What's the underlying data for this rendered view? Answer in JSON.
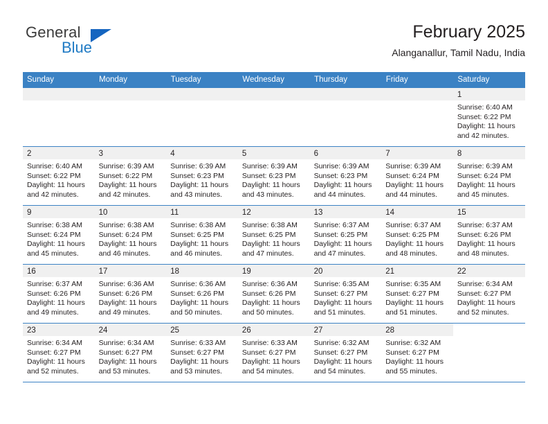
{
  "brand": {
    "name_part1": "General",
    "name_part2": "Blue",
    "triangle_color": "#1565c0",
    "blue_color": "#1f7ac4"
  },
  "header": {
    "title": "February 2025",
    "subtitle": "Alanganallur, Tamil Nadu, India"
  },
  "theme": {
    "header_bg": "#3b82c4",
    "header_text": "#ffffff",
    "daynum_band_bg": "#f0f0f0",
    "grid_line": "#3b82c4",
    "text": "#231f20"
  },
  "weekdays": [
    "Sunday",
    "Monday",
    "Tuesday",
    "Wednesday",
    "Thursday",
    "Friday",
    "Saturday"
  ],
  "labels": {
    "sunrise_prefix": "Sunrise:",
    "sunset_prefix": "Sunset:",
    "daylight_prefix": "Daylight:"
  },
  "weeks": [
    [
      {
        "day": "",
        "empty": true
      },
      {
        "day": "",
        "empty": true
      },
      {
        "day": "",
        "empty": true
      },
      {
        "day": "",
        "empty": true
      },
      {
        "day": "",
        "empty": true
      },
      {
        "day": "",
        "empty": true
      },
      {
        "day": "1",
        "sunrise": "Sunrise: 6:40 AM",
        "sunset": "Sunset: 6:22 PM",
        "daylight1": "Daylight: 11 hours",
        "daylight2": "and 42 minutes."
      }
    ],
    [
      {
        "day": "2",
        "sunrise": "Sunrise: 6:40 AM",
        "sunset": "Sunset: 6:22 PM",
        "daylight1": "Daylight: 11 hours",
        "daylight2": "and 42 minutes."
      },
      {
        "day": "3",
        "sunrise": "Sunrise: 6:39 AM",
        "sunset": "Sunset: 6:22 PM",
        "daylight1": "Daylight: 11 hours",
        "daylight2": "and 42 minutes."
      },
      {
        "day": "4",
        "sunrise": "Sunrise: 6:39 AM",
        "sunset": "Sunset: 6:23 PM",
        "daylight1": "Daylight: 11 hours",
        "daylight2": "and 43 minutes."
      },
      {
        "day": "5",
        "sunrise": "Sunrise: 6:39 AM",
        "sunset": "Sunset: 6:23 PM",
        "daylight1": "Daylight: 11 hours",
        "daylight2": "and 43 minutes."
      },
      {
        "day": "6",
        "sunrise": "Sunrise: 6:39 AM",
        "sunset": "Sunset: 6:23 PM",
        "daylight1": "Daylight: 11 hours",
        "daylight2": "and 44 minutes."
      },
      {
        "day": "7",
        "sunrise": "Sunrise: 6:39 AM",
        "sunset": "Sunset: 6:24 PM",
        "daylight1": "Daylight: 11 hours",
        "daylight2": "and 44 minutes."
      },
      {
        "day": "8",
        "sunrise": "Sunrise: 6:39 AM",
        "sunset": "Sunset: 6:24 PM",
        "daylight1": "Daylight: 11 hours",
        "daylight2": "and 45 minutes."
      }
    ],
    [
      {
        "day": "9",
        "sunrise": "Sunrise: 6:38 AM",
        "sunset": "Sunset: 6:24 PM",
        "daylight1": "Daylight: 11 hours",
        "daylight2": "and 45 minutes."
      },
      {
        "day": "10",
        "sunrise": "Sunrise: 6:38 AM",
        "sunset": "Sunset: 6:24 PM",
        "daylight1": "Daylight: 11 hours",
        "daylight2": "and 46 minutes."
      },
      {
        "day": "11",
        "sunrise": "Sunrise: 6:38 AM",
        "sunset": "Sunset: 6:25 PM",
        "daylight1": "Daylight: 11 hours",
        "daylight2": "and 46 minutes."
      },
      {
        "day": "12",
        "sunrise": "Sunrise: 6:38 AM",
        "sunset": "Sunset: 6:25 PM",
        "daylight1": "Daylight: 11 hours",
        "daylight2": "and 47 minutes."
      },
      {
        "day": "13",
        "sunrise": "Sunrise: 6:37 AM",
        "sunset": "Sunset: 6:25 PM",
        "daylight1": "Daylight: 11 hours",
        "daylight2": "and 47 minutes."
      },
      {
        "day": "14",
        "sunrise": "Sunrise: 6:37 AM",
        "sunset": "Sunset: 6:25 PM",
        "daylight1": "Daylight: 11 hours",
        "daylight2": "and 48 minutes."
      },
      {
        "day": "15",
        "sunrise": "Sunrise: 6:37 AM",
        "sunset": "Sunset: 6:26 PM",
        "daylight1": "Daylight: 11 hours",
        "daylight2": "and 48 minutes."
      }
    ],
    [
      {
        "day": "16",
        "sunrise": "Sunrise: 6:37 AM",
        "sunset": "Sunset: 6:26 PM",
        "daylight1": "Daylight: 11 hours",
        "daylight2": "and 49 minutes."
      },
      {
        "day": "17",
        "sunrise": "Sunrise: 6:36 AM",
        "sunset": "Sunset: 6:26 PM",
        "daylight1": "Daylight: 11 hours",
        "daylight2": "and 49 minutes."
      },
      {
        "day": "18",
        "sunrise": "Sunrise: 6:36 AM",
        "sunset": "Sunset: 6:26 PM",
        "daylight1": "Daylight: 11 hours",
        "daylight2": "and 50 minutes."
      },
      {
        "day": "19",
        "sunrise": "Sunrise: 6:36 AM",
        "sunset": "Sunset: 6:26 PM",
        "daylight1": "Daylight: 11 hours",
        "daylight2": "and 50 minutes."
      },
      {
        "day": "20",
        "sunrise": "Sunrise: 6:35 AM",
        "sunset": "Sunset: 6:27 PM",
        "daylight1": "Daylight: 11 hours",
        "daylight2": "and 51 minutes."
      },
      {
        "day": "21",
        "sunrise": "Sunrise: 6:35 AM",
        "sunset": "Sunset: 6:27 PM",
        "daylight1": "Daylight: 11 hours",
        "daylight2": "and 51 minutes."
      },
      {
        "day": "22",
        "sunrise": "Sunrise: 6:34 AM",
        "sunset": "Sunset: 6:27 PM",
        "daylight1": "Daylight: 11 hours",
        "daylight2": "and 52 minutes."
      }
    ],
    [
      {
        "day": "23",
        "sunrise": "Sunrise: 6:34 AM",
        "sunset": "Sunset: 6:27 PM",
        "daylight1": "Daylight: 11 hours",
        "daylight2": "and 52 minutes."
      },
      {
        "day": "24",
        "sunrise": "Sunrise: 6:34 AM",
        "sunset": "Sunset: 6:27 PM",
        "daylight1": "Daylight: 11 hours",
        "daylight2": "and 53 minutes."
      },
      {
        "day": "25",
        "sunrise": "Sunrise: 6:33 AM",
        "sunset": "Sunset: 6:27 PM",
        "daylight1": "Daylight: 11 hours",
        "daylight2": "and 53 minutes."
      },
      {
        "day": "26",
        "sunrise": "Sunrise: 6:33 AM",
        "sunset": "Sunset: 6:27 PM",
        "daylight1": "Daylight: 11 hours",
        "daylight2": "and 54 minutes."
      },
      {
        "day": "27",
        "sunrise": "Sunrise: 6:32 AM",
        "sunset": "Sunset: 6:27 PM",
        "daylight1": "Daylight: 11 hours",
        "daylight2": "and 54 minutes."
      },
      {
        "day": "28",
        "sunrise": "Sunrise: 6:32 AM",
        "sunset": "Sunset: 6:27 PM",
        "daylight1": "Daylight: 11 hours",
        "daylight2": "and 55 minutes."
      },
      {
        "day": "",
        "empty": true,
        "blank": true
      }
    ]
  ]
}
